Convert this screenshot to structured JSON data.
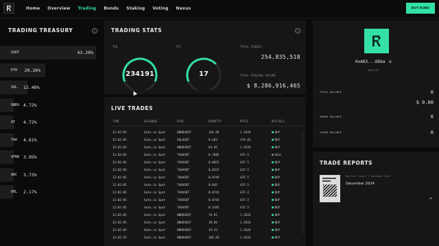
{
  "nav": {
    "items": [
      {
        "label": "Home",
        "active": false
      },
      {
        "label": "Overview",
        "active": false
      },
      {
        "label": "Trading",
        "active": true
      },
      {
        "label": "Bonds",
        "active": false
      },
      {
        "label": "Staking",
        "active": false
      },
      {
        "label": "Voting",
        "active": false
      },
      {
        "label": "Nexus",
        "active": false
      }
    ],
    "cta_label": "BUY ROBO"
  },
  "treasury": {
    "title": "TRADING TREASURY",
    "info": "i",
    "rows": [
      {
        "symbol": "USDT",
        "percent": "43.28%",
        "share": 43.28
      },
      {
        "symbol": "ETH",
        "percent": "20.26%",
        "share": 20.26
      },
      {
        "symbol": "SOL",
        "percent": "12.48%",
        "share": 12.48
      },
      {
        "symbol": "ONDO",
        "percent": "4.72%",
        "share": 4.72
      },
      {
        "symbol": "AT",
        "percent": "4.72%",
        "share": 4.72
      },
      {
        "symbol": "TAO",
        "percent": "4.61%",
        "share": 4.61
      },
      {
        "symbol": "VFRB",
        "percent": "3.95%",
        "share": 3.95
      },
      {
        "symbol": "ARC",
        "percent": "3.73%",
        "share": 3.73
      },
      {
        "symbol": "ORL",
        "percent": "2.17%",
        "share": 2.17
      }
    ]
  },
  "stats": {
    "title": "TRADING STATS",
    "info": "i",
    "gauge1": {
      "label": "TPD",
      "value": "234191",
      "fill": 0.78
    },
    "gauge2": {
      "label": "TPS",
      "value": "17",
      "fill": 0.55
    },
    "total_trades_label": "TOTAL TRADES",
    "total_trades_value": "254,835,518",
    "total_volume_label": "TOTAL TRADING VOLUME",
    "total_volume_value": "$ 8,286,916,465"
  },
  "trades": {
    "title": "LIVE TRADES",
    "columns": [
      "TIME",
      "EXCHANGE",
      "PAIR",
      "QUANTITY",
      "PRICE",
      "BUY/SELL"
    ],
    "rows": [
      [
        "12:02:05",
        "Gate.io Spot",
        "ONDOUSDT",
        "164.09",
        "1.2624",
        "BUY",
        "buy"
      ],
      [
        "12:02:05",
        "Gate.io Spot",
        "SOLUSDT",
        "0.402",
        "179.82",
        "BUY",
        "buy"
      ],
      [
        "12:02:05",
        "Gate.io Spot",
        "ONDOUSDT",
        "84.85",
        "1.2624",
        "BUY",
        "buy"
      ],
      [
        "12:02:05",
        "Gate.io Spot",
        "TAOUSDT",
        "0.7085",
        "437.5",
        "SELL",
        "sell"
      ],
      [
        "12:02:05",
        "Gate.io Spot",
        "TAOUSDT",
        "0.0852",
        "437.5",
        "BUY",
        "buy"
      ],
      [
        "12:02:05",
        "Gate.io Spot",
        "TAOUSDT",
        "0.0337",
        "437.5",
        "BUY",
        "buy"
      ],
      [
        "12:02:05",
        "Gate.io Spot",
        "TAOUSDT",
        "0.0749",
        "437.5",
        "BUY",
        "buy"
      ],
      [
        "12:02:05",
        "Gate.io Spot",
        "TAOUSDT",
        "0.045",
        "437.5",
        "BUY",
        "buy"
      ],
      [
        "12:02:05",
        "Gate.io Spot",
        "TAOUSDT",
        "0.0743",
        "437.4",
        "BUY",
        "buy"
      ],
      [
        "12:02:05",
        "Gate.io Spot",
        "TAOUSDT",
        "0.0743",
        "437.5",
        "BUY",
        "buy"
      ],
      [
        "12:02:05",
        "Gate.io Spot",
        "TAOUSDT",
        "0.3185",
        "437.5",
        "BUY",
        "buy"
      ],
      [
        "12:02:05",
        "Gate.io Spot",
        "ONDOUSDT",
        "76.91",
        "1.2624",
        "BUY",
        "buy"
      ],
      [
        "12:02:05",
        "Gate.io Spot",
        "ONDOUSDT",
        "18.86",
        "1.2624",
        "BUY",
        "buy"
      ],
      [
        "12:02:05",
        "Gate.io Spot",
        "ONDOUSDT",
        "19.23",
        "1.2624",
        "BUY",
        "buy"
      ],
      [
        "12:01:55",
        "Gate.io Spot",
        "ONDOUSDT",
        "166.93",
        "1.2624",
        "BUY",
        "buy"
      ]
    ]
  },
  "profile": {
    "address": "0xA83...6bba",
    "address_sub": "ROBO NFT",
    "balances": [
      {
        "label": "TOTAL BALANCE",
        "value": "0"
      },
      {
        "label": "",
        "value": "$ 0.00"
      },
      {
        "label": "$ROBO BALANCE",
        "value": "0"
      },
      {
        "label": "sROBO BALANCE",
        "value": "0"
      }
    ]
  },
  "reports": {
    "title": "TRADE REPORTS",
    "subtitle": "Monthly report / December 2024",
    "name": "December 2024",
    "arrow": "→"
  },
  "colors": {
    "accent": "#33e0a6",
    "panel": "#161616",
    "bg": "#0b0b0b"
  }
}
